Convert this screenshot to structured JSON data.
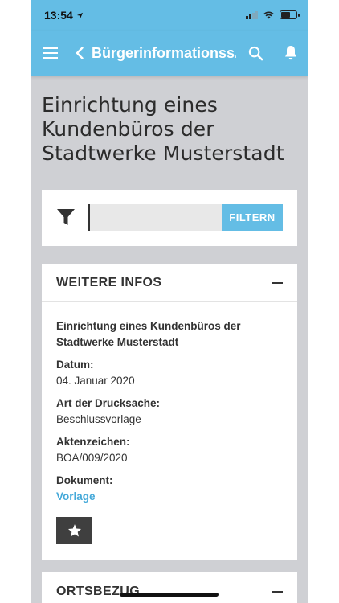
{
  "status_bar": {
    "time": "13:54",
    "battery_level": 0.55
  },
  "app_bar": {
    "title": "Bürgerinformationss...",
    "icons": [
      "menu-icon",
      "back-icon",
      "search-icon",
      "bell-icon"
    ]
  },
  "page": {
    "title": "Einrichtung eines Kundenbüros der Stadtwerke Musterstadt"
  },
  "filter": {
    "placeholder": "",
    "value": "",
    "button_label": "FILTERN"
  },
  "info_card": {
    "header": "WEITERE INFOS",
    "description": "Einrichtung eines Kundenbüros der Stadtwerke Musterstadt",
    "fields": [
      {
        "label": "Datum:",
        "value": "04. Januar 2020"
      },
      {
        "label": "Art der Drucksache:",
        "value": "Beschlussvorlage"
      },
      {
        "label": "Aktenzeichen:",
        "value": "BOA/009/2020"
      }
    ],
    "document_label": "Dokument:",
    "document_link": "Vorlage"
  },
  "ortsbezug_card": {
    "header": "ORTSBEZUG"
  },
  "colors": {
    "primary": "#64bde5",
    "link": "#45a9d9",
    "background": "#cfd0d4",
    "dark_button": "#3f3f3f"
  }
}
